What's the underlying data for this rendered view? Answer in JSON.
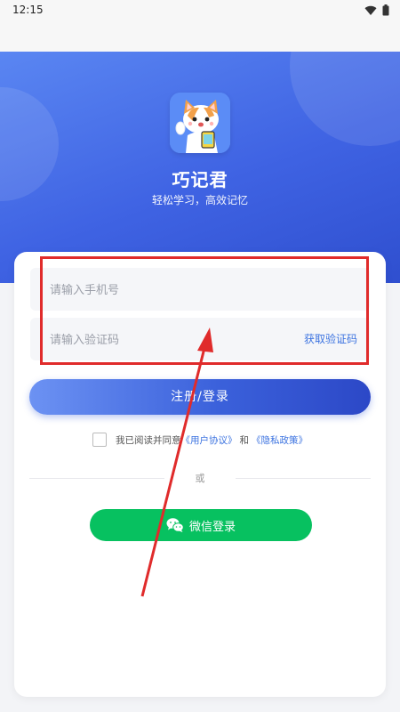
{
  "status_bar": {
    "time": "12:15",
    "icons": [
      "wifi-icon",
      "battery-icon"
    ]
  },
  "hero": {
    "app_name": "巧记君",
    "tagline": "轻松学习，高效记忆",
    "logo_icon": "cat-mascot-logo"
  },
  "form": {
    "phone_placeholder": "请输入手机号",
    "code_placeholder": "请输入验证码",
    "get_code_label": "获取验证码",
    "submit_label": "注册/登录"
  },
  "agreement": {
    "prefix": "我已阅读并同意",
    "user_agreement": "《用户协议》",
    "conjunction": "和",
    "privacy_policy": "《隐私政策》"
  },
  "divider": {
    "text": "或"
  },
  "wechat": {
    "label": "微信登录",
    "icon": "wechat-icon"
  },
  "annotation": {
    "color": "#e02b2b"
  },
  "colors": {
    "primary": "#3f63e3",
    "wechat_green": "#07c160",
    "link": "#3c73e0"
  }
}
